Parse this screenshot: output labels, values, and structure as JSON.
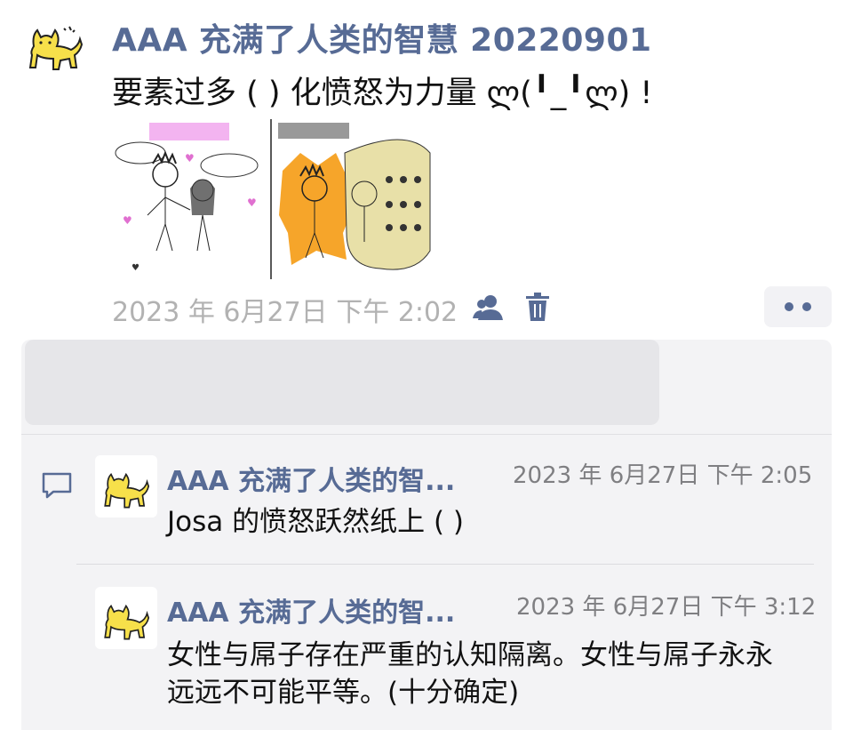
{
  "post": {
    "author": "AAA 充满了人类的智慧 20220901",
    "text": "要素过多 ( ) 化愤怒为力量 ლ(╹_╹ლ) !",
    "timestamp": "2023 年 6月27日 下午 2:02",
    "privacy_icon": "contacts-icon",
    "delete_icon": "trash-icon",
    "more_icon": "more-dots-icon"
  },
  "comments": [
    {
      "author": "AAA 充满了人类的智...",
      "time": "2023 年 6月27日 下午 2:05",
      "text": "Josa 的愤怒跃然纸上 ( )"
    },
    {
      "author": "AAA 充满了人类的智...",
      "time": "2023 年 6月27日 下午 3:12",
      "text": "女性与屌子存在严重的认知隔离。女性与屌子永永远远不可能平等。(十分确定)"
    }
  ],
  "colors": {
    "name_blue": "#576b95",
    "meta_gray": "#b2b2b2",
    "panel_bg": "#f3f3f5"
  }
}
